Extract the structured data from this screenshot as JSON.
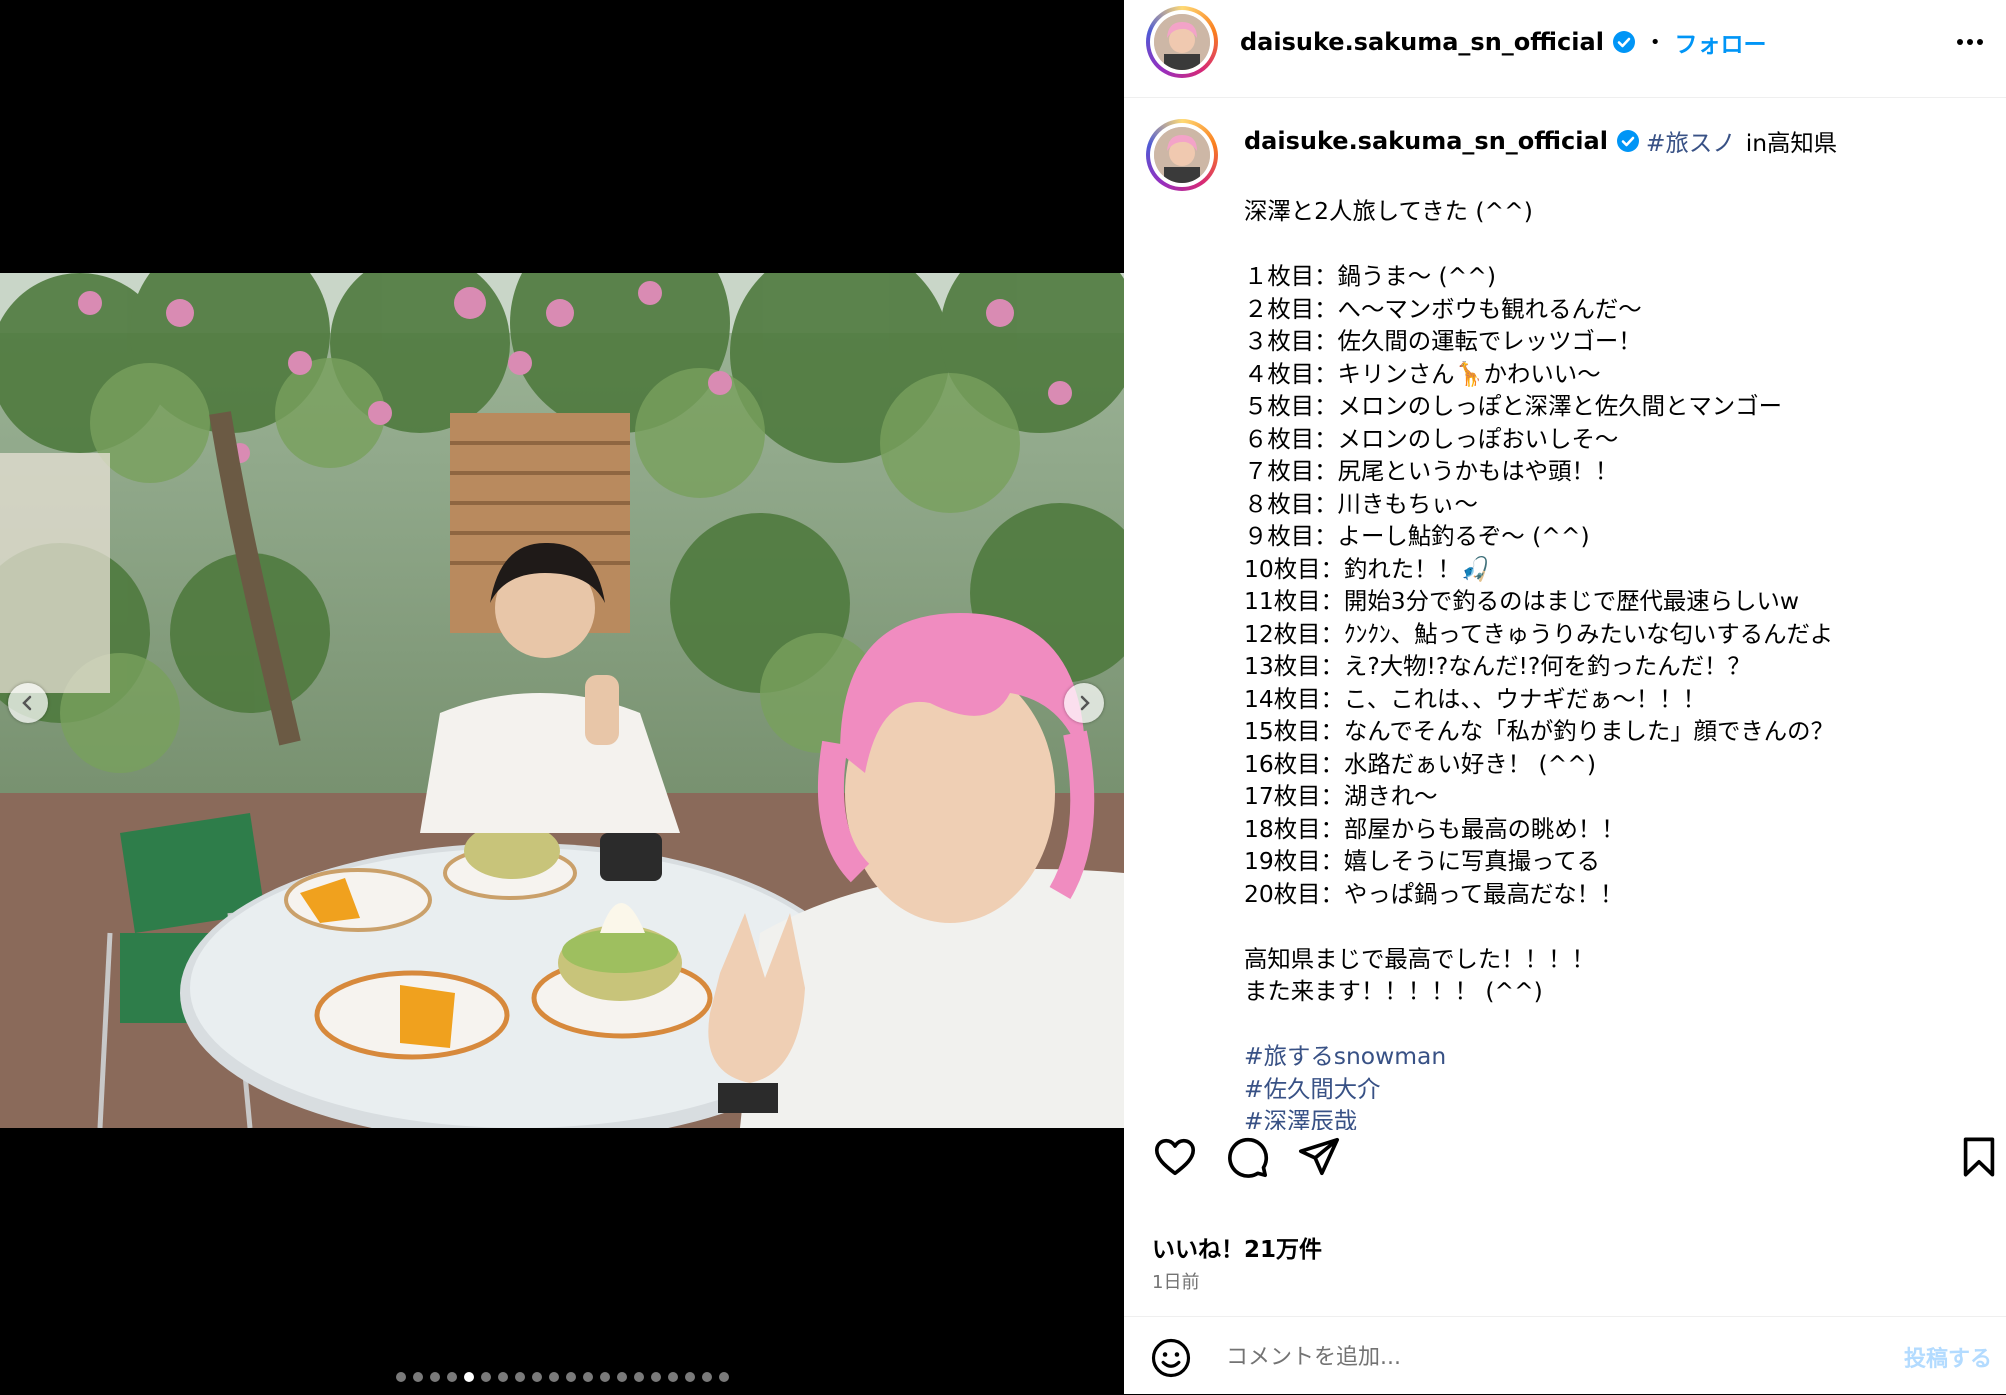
{
  "header": {
    "username": "daisuke.sakuma_sn_official",
    "separator": "•",
    "follow_label": "フォロー",
    "more_icon": "more-horizontal-icon"
  },
  "caption": {
    "username": "daisuke.sakuma_sn_official",
    "hashtag": "#旅スノ",
    "location": "in高知県",
    "lines": [
      "深澤と2人旅してきた (^^)",
      "",
      "１枚目：鍋うま〜 (^^)",
      "２枚目：へ〜マンボウも観れるんだ〜",
      "３枚目：佐久間の運転でレッツゴー！",
      "４枚目：キリンさん🦒かわいい〜",
      "５枚目：メロンのしっぽと深澤と佐久間とマンゴー",
      "６枚目：メロンのしっぽおいしそ〜",
      "７枚目：尻尾というかもはや頭！！",
      "８枚目：川きもちぃ〜",
      "９枚目：よーし鮎釣るぞ〜 (^^)",
      "10枚目：釣れた！！🎣",
      "11枚目：開始3分で釣るのはまじで歴代最速らしいw",
      "12枚目：ｸﾝｸﾝ、鮎ってきゅうりみたいな匂いするんだよ",
      "13枚目：え?大物!?なんだ!?何を釣ったんだ！？",
      "14枚目：こ、これは、、ウナギだぁ〜！！！",
      "15枚目：なんでそんな「私が釣りました」顔できんの？",
      "16枚目：水路だぁい好き！ (^^)",
      "17枚目：湖きれ〜",
      "18枚目：部屋からも最高の眺め！！",
      "19枚目：嬉しそうに写真撮ってる",
      "20枚目：やっぱ鍋って最高だな！！",
      "",
      "高知県まじで最高でした！！！！",
      "また来ます！！！！！ (^^)",
      ""
    ],
    "tags": [
      "#旅するsnowman",
      "#佐久間大介",
      "#深澤辰哉"
    ]
  },
  "actions": {
    "like_icon": "heart-icon",
    "comment_icon": "comment-bubble-icon",
    "share_icon": "paper-plane-icon",
    "save_icon": "bookmark-icon"
  },
  "likes_text": "いいね！21万件",
  "time_ago": "1日前",
  "comment": {
    "placeholder": "コメントを追加...",
    "post_label": "投稿する",
    "emoji_icon": "smiley-icon"
  },
  "carousel": {
    "total": 20,
    "current": 5,
    "prev_icon": "chevron-left-icon",
    "next_icon": "chevron-right-icon"
  },
  "colors": {
    "link": "#385185",
    "follow": "#0095f6",
    "verified": "#0095f6",
    "post_button": "#b3dbff",
    "pink_hair": "#f08cc0"
  }
}
